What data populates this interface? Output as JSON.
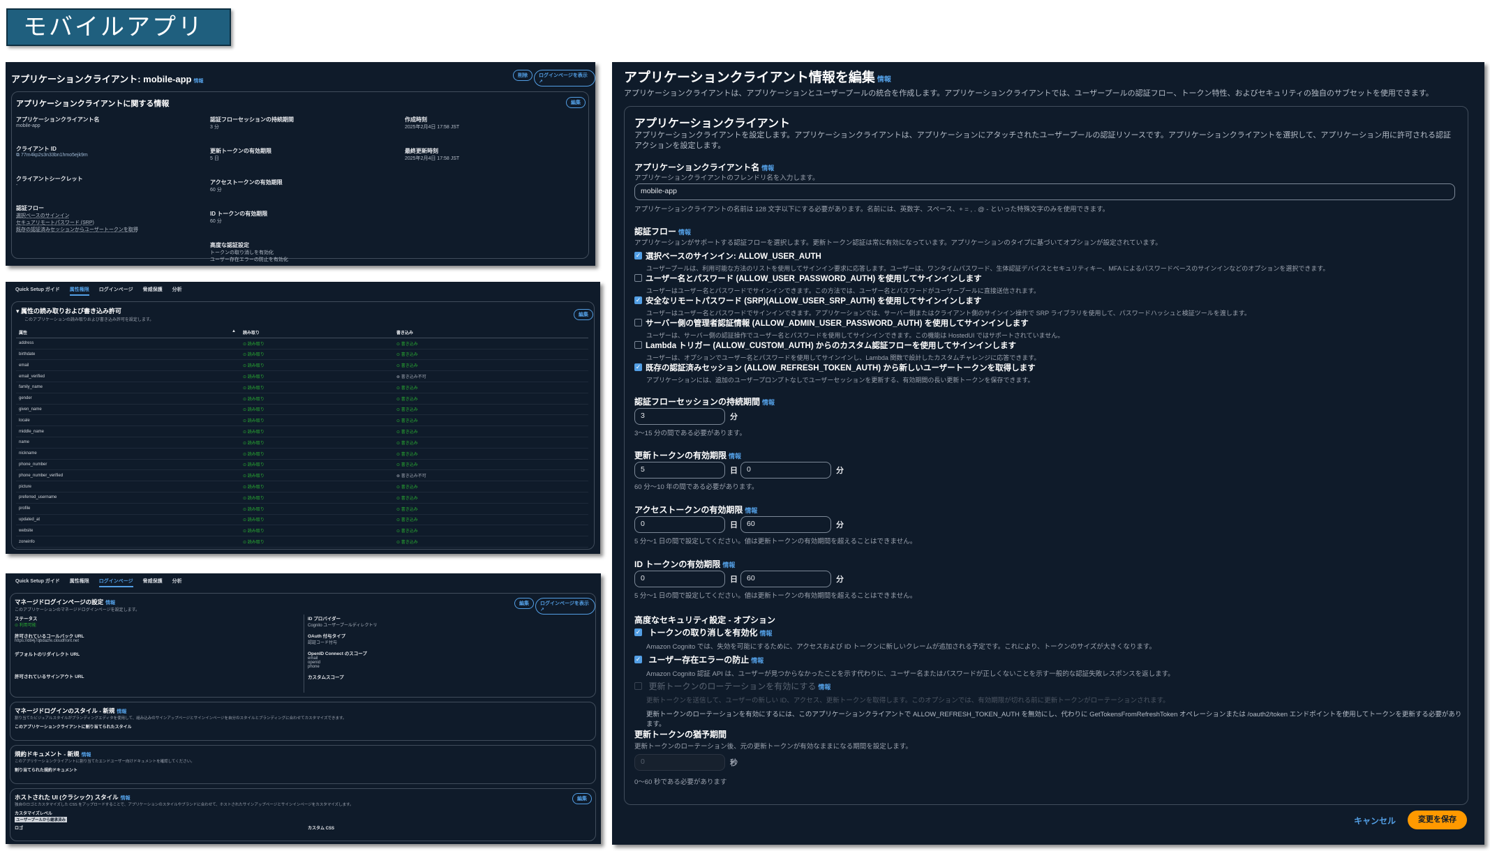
{
  "banner": {
    "title": "モバイルアプリ"
  },
  "shot1": {
    "title": "アプリケーションクライアント: mobile-app",
    "info": "情報",
    "btn_delete": "削除",
    "btn_login": "ログインページを表示 ↗",
    "section_title": "アプリケーションクライアントに関する情報",
    "btn_edit": "編集",
    "col1": [
      {
        "label": "アプリケーションクライアント名",
        "value": "mobile-app"
      },
      {
        "label": "クライアント ID",
        "value": "77m4kp2s3n33bn1hmo5ejk9m"
      },
      {
        "label": "クライアントシークレット",
        "value": "-"
      },
      {
        "label": "認証フロー",
        "lines": [
          "選択ベースのサインイン",
          "セキュアリモートパスワード (SRP)",
          "既存の認証済みセッションからユーザートークンを取得"
        ]
      }
    ],
    "col2": [
      {
        "label": "認証フローセッションの持続期間",
        "value": "3 分"
      },
      {
        "label": "更新トークンの有効期限",
        "value": "5 日"
      },
      {
        "label": "アクセストークンの有効期限",
        "value": "60 分"
      },
      {
        "label": "ID トークンの有効期限",
        "value": "60 分"
      },
      {
        "label": "高度な認証設定",
        "lines": [
          "トークンの取り消しを有効化",
          "ユーザー存在エラーの防止を有効化"
        ]
      }
    ],
    "col3": [
      {
        "label": "作成時刻",
        "value": "2025年2月4日 17:58 JST"
      },
      {
        "label": "最終更新時刻",
        "value": "2025年2月4日 17:58 JST"
      }
    ]
  },
  "shot2": {
    "tabs": [
      "Quick Setup ガイド",
      "属性権限",
      "ログインページ",
      "脅威保護",
      "分析"
    ],
    "active_tab": "属性権限",
    "section_title": "属性の読み取りおよび書き込み許可",
    "desc": "このアプリケーションの読み取りおよび書き込み許可を設定します。",
    "btn_edit": "編集",
    "headers": [
      "属性",
      "読み取り",
      "書き込み"
    ],
    "rows": [
      {
        "attr": "address",
        "read": "読み取り",
        "write": "書き込み"
      },
      {
        "attr": "birthdate",
        "read": "読み取り",
        "write": "書き込み"
      },
      {
        "attr": "email",
        "read": "読み取り",
        "write": "書き込み"
      },
      {
        "attr": "email_verified",
        "read": "読み取り",
        "write": "書き込み不可"
      },
      {
        "attr": "family_name",
        "read": "読み取り",
        "write": "書き込み"
      },
      {
        "attr": "gender",
        "read": "読み取り",
        "write": "書き込み"
      },
      {
        "attr": "given_name",
        "read": "読み取り",
        "write": "書き込み"
      },
      {
        "attr": "locale",
        "read": "読み取り",
        "write": "書き込み"
      },
      {
        "attr": "middle_name",
        "read": "読み取り",
        "write": "書き込み"
      },
      {
        "attr": "name",
        "read": "読み取り",
        "write": "書き込み"
      },
      {
        "attr": "nickname",
        "read": "読み取り",
        "write": "書き込み"
      },
      {
        "attr": "phone_number",
        "read": "読み取り",
        "write": "書き込み"
      },
      {
        "attr": "phone_number_verified",
        "read": "読み取り",
        "write": "書き込み不可"
      },
      {
        "attr": "picture",
        "read": "読み取り",
        "write": "書き込み"
      },
      {
        "attr": "preferred_username",
        "read": "読み取り",
        "write": "書き込み"
      },
      {
        "attr": "profile",
        "read": "読み取り",
        "write": "書き込み"
      },
      {
        "attr": "updated_at",
        "read": "読み取り",
        "write": "書き込み"
      },
      {
        "attr": "website",
        "read": "読み取り",
        "write": "書き込み"
      },
      {
        "attr": "zoneinfo",
        "read": "読み取り",
        "write": "書き込み"
      }
    ]
  },
  "shot3": {
    "tabs": [
      "Quick Setup ガイド",
      "属性権限",
      "ログインページ",
      "脅威保護",
      "分析"
    ],
    "active_tab": "ログインページ",
    "managed_title": "マネージドログインページの設定",
    "managed_desc": "このアプリケーションのマネージドログインページを設定します。",
    "btn_edit": "編集",
    "btn_login": "ログインページを表示 ↗",
    "status_label": "ステータス",
    "status_value": "利用可能",
    "callback_label": "許可されているコールバック URL",
    "callback_value": "https://d84j7qbdazfe.cloudfront.net",
    "redirect_label": "デフォルトのリダイレクト URL",
    "signout_label": "許可されているサインアウト URL",
    "idp_label": "ID プロバイダー",
    "idp_value": "Cognito ユーザープールディレクトリ",
    "oauth_label": "OAuth 付与タイプ",
    "oauth_value": "認証コード付与",
    "scope_label": "OpenID Connect のスコープ",
    "scope_values": [
      "email",
      "openid",
      "phone"
    ],
    "custom_scope_label": "カスタムスコープ",
    "style_title": "マネージドログインのスタイル - 新規",
    "style_desc": "割り当てたビジュアルスタイルがブランディングエディタを使用して、組み込みのサインアップページとサインインページを自分のスタイルとブランディングに合わせてカスタマイズできます。",
    "style_note": "このアプリケーションクライアントに割り当てられたスタイル",
    "doc_title": "規約ドキュメント - 新規",
    "doc_desc": "このアプリケーションクライアントに割り当てたエンドユーザー向けドキュメントを確認してください。",
    "doc_note": "割り当てられた規約ドキュメント",
    "hosted_title": "ホストされた UI (クラシック) スタイル",
    "hosted_desc": "独自のロゴとカスタマイズした CSS をアップロードすることで、アプリケーションのスタイルやブランドに合わせて、ホストされたサインアップページとサインインページをカスタマイズします。",
    "custom_level_label": "カスタマイズレベル",
    "custom_level_value": "ユーザープールから継承済み",
    "logo_label": "ロゴ",
    "css_label": "カスタム CSS",
    "info": "情報"
  },
  "shot4": {
    "title": "アプリケーションクライアント情報を編集",
    "info": "情報",
    "intro": "アプリケーションクライアントは、アプリケーションとユーザープールの統合を作成します。アプリケーションクライアントでは、ユーザープールの認証フロー、トークン特性、およびセキュリティの独自のサブセットを使用できます。",
    "card_title": "アプリケーションクライアント",
    "card_desc": "アプリケーションクライアントを設定します。アプリケーションクライアントは、アプリケーションにアタッチされたユーザープールの認証リソースです。アプリケーションクライアントを選択して、アプリケーション用に許可される認証アクションを設定します。",
    "name_label": "アプリケーションクライアント名",
    "name_desc": "アプリケーションクライアントのフレンドリ名を入力します。",
    "name_value": "mobile-app",
    "name_hint": "アプリケーションクライアントの名前は 128 文字以下にする必要があります。名前には、英数字、スペース、+ = , . @ - といった特殊文字のみを使用できます。",
    "flow_label": "認証フロー",
    "flow_desc": "アプリケーションがサポートする認証フローを選択します。更新トークン認証は常に有効になっています。アプリケーションのタイプに基づいてオプションが設定されています。",
    "flows": [
      {
        "title": "選択ベースのサインイン: ALLOW_USER_AUTH",
        "desc": "ユーザープールは、利用可能な方法のリストを使用してサインイン要求に応答します。ユーザーは、ワンタイムパスワード、生体認証デバイスとセキュリティキー、MFA によるパスワードベースのサインインなどのオプションを選択できます。",
        "checked": true
      },
      {
        "title": "ユーザー名とパスワード (ALLOW_USER_PASSWORD_AUTH) を使用してサインインします",
        "desc": "ユーザーはユーザー名とパスワードでサインインできます。この方法では、ユーザー名とパスワードがユーザープールに直接送信されます。",
        "checked": false
      },
      {
        "title": "安全なリモートパスワード (SRP)(ALLOW_USER_SRP_AUTH) を使用してサインインします",
        "desc": "ユーザーはユーザー名とパスワードでサインインできます。アプリケーションでは、サーバー側またはクライアント側のサインイン操作で SRP ライブラリを使用して、パスワードハッシュと検証ツールを渡します。",
        "checked": true
      },
      {
        "title": "サーバー側の管理者認証情報 (ALLOW_ADMIN_USER_PASSWORD_AUTH) を使用してサインインします",
        "desc": "ユーザーは、サーバー側の認証操作でユーザー名とパスワードを使用してサインインできます。この機能は HostedUI ではサポートされていません。",
        "checked": false
      },
      {
        "title": "Lambda トリガー (ALLOW_CUSTOM_AUTH) からのカスタム認証フローを使用してサインインします",
        "desc": "ユーザーは、オプションでユーザー名とパスワードを使用してサインインし、Lambda 関数で設計したカスタムチャレンジに応答できます。",
        "checked": false
      },
      {
        "title": "既存の認証済みセッション (ALLOW_REFRESH_TOKEN_AUTH) から新しいユーザートークンを取得します",
        "desc": "アプリケーションには、追加のユーザープロンプトなしでユーザーセッションを更新する、有効期間の長い更新トークンを保存できます。",
        "checked": true
      }
    ],
    "session_label": "認証フローセッションの持続期間",
    "session_value": "3",
    "session_unit": "分",
    "session_hint": "3～15 分の間である必要があります。",
    "refresh_label": "更新トークンの有効期限",
    "refresh_days": "5",
    "refresh_mins": "0",
    "refresh_hint": "60 分～10 年の間である必要があります。",
    "access_label": "アクセストークンの有効期限",
    "access_days": "0",
    "access_mins": "60",
    "access_hint": "5 分～1 日の間で設定してください。値は更新トークンの有効期間を超えることはできません。",
    "id_label": "ID トークンの有効期限",
    "id_days": "0",
    "id_mins": "60",
    "id_hint": "5 分～1 日の間で設定してください。値は更新トークンの有効期間を超えることはできません。",
    "unit_day": "日",
    "unit_min": "分",
    "adv_label": "高度なセキュリティ設定 - オプション",
    "revoke_title": "トークンの取り消しを有効化",
    "revoke_desc": "Amazon Cognito では、失効を可能にするために、アクセスおよび ID トークンに新しいクレームが追加される予定です。これにより、トークンのサイズが大きくなります。",
    "prevent_title": "ユーザー存在エラーの防止",
    "prevent_desc": "Amazon Cognito 認証 API は、ユーザーが見つからなかったことを示す代わりに、ユーザー名またはパスワードが正しくないことを示す一般的な認証失敗レスポンスを返します。",
    "rotate_title": "更新トークンのローテーションを有効にする",
    "rotate_desc": "更新トークンを送信して、ユーザーの新しい ID、アクセス、更新トークンを取得します。このオプションでは、有効期限が切れる前に更新トークンがローテーションされます。",
    "rotate_note": "更新トークンのローテーションを有効にするには、このアプリケーションクライアントで ALLOW_REFRESH_TOKEN_AUTH を無効にし、代わりに GetTokensFromRefreshToken オペレーションまたは /oauth2/token エンドポイントを使用してトークンを更新する必要があります。",
    "grace_label": "更新トークンの猶予期間",
    "grace_desc": "更新トークンのローテーション後、元の更新トークンが有効なままになる期間を設定します。",
    "grace_value": "0",
    "grace_unit": "秒",
    "grace_hint": "0～60 秒である必要があります",
    "cancel": "キャンセル",
    "save": "変更を保存"
  },
  "colors": {
    "accent": "#539fe5",
    "save": "#ff9900",
    "green": "#29ad32",
    "bg": "#0f1b2a",
    "banner": "#1f5f7e"
  }
}
